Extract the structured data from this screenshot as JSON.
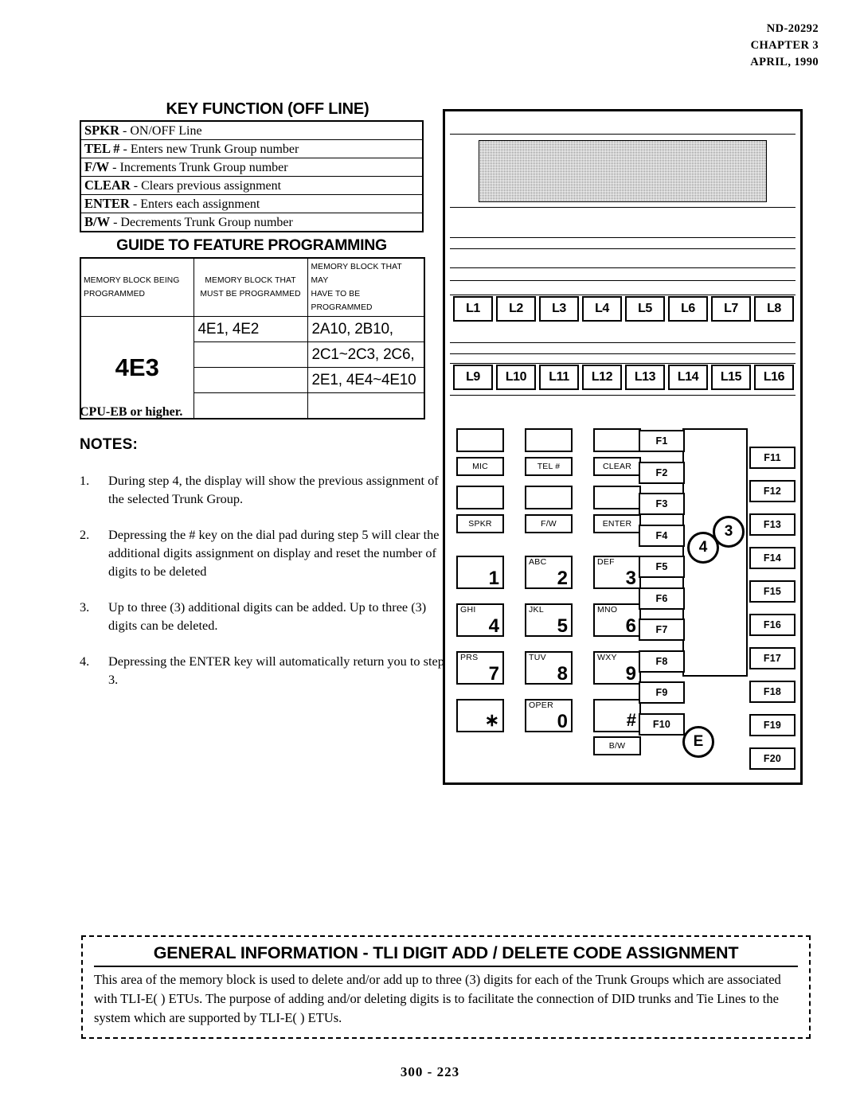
{
  "header": {
    "doc_number": "ND-20292",
    "chapter": "CHAPTER 3",
    "date": "APRIL, 1990"
  },
  "key_function": {
    "title": "KEY FUNCTION (OFF LINE)",
    "rows": [
      {
        "key": "SPKR",
        "sep": " -  ",
        "desc": "ON/OFF Line"
      },
      {
        "key": "TEL #",
        "sep": " - ",
        "desc": "Enters new Trunk Group number"
      },
      {
        "key": "F/W",
        "sep": " -  ",
        "desc": "Increments  Trunk Group number"
      },
      {
        "key": "CLEAR",
        "sep": " -  ",
        "desc": "Clears previous assignment"
      },
      {
        "key": "ENTER",
        "sep": " - ",
        "desc": "Enters each assignment"
      },
      {
        "key": "B/W",
        "sep": " -  ",
        "desc": "Decrements Trunk Group number"
      }
    ]
  },
  "guide": {
    "title": "GUIDE TO FEATURE PROGRAMMING",
    "headers": {
      "col1_line1": "MEMORY BLOCK BEING",
      "col1_line2": "PROGRAMMED",
      "col2_line1": "MEMORY BLOCK THAT",
      "col2_line2": "MUST BE PROGRAMMED",
      "col3_line1": "MEMORY BLOCK THAT MAY",
      "col3_line2": "HAVE TO BE PROGRAMMED"
    },
    "memory_block": "4E3",
    "must_rows": [
      "4E1, 4E2",
      "",
      "",
      ""
    ],
    "may_rows": [
      "2A10, 2B10,",
      "2C1~2C3, 2C6,",
      "2E1, 4E4~4E10",
      ""
    ],
    "cpu_note": "CPU-EB or higher."
  },
  "notes": {
    "title": "NOTES:",
    "items": [
      {
        "num": "1.",
        "text": "During step 4,  the display will show the previous assignment of the selected Trunk Group."
      },
      {
        "num": "2.",
        "text": "Depressing the # key on the dial pad during step 5 will clear the additional digits assignment on display and reset the number of digits to be deleted"
      },
      {
        "num": "3.",
        "text": "Up to three (3) additional digits can be added.  Up to three (3) digits can be deleted."
      },
      {
        "num": "4.",
        "text": "Depressing the ENTER key will  automatically return you to step 3."
      }
    ]
  },
  "phone": {
    "line_keys_row1": [
      "L1",
      "L2",
      "L3",
      "L4",
      "L5",
      "L6",
      "L7",
      "L8"
    ],
    "line_keys_row2": [
      "L9",
      "L10",
      "L11",
      "L12",
      "L13",
      "L14",
      "L15",
      "L16"
    ],
    "control_keys": [
      "MIC",
      "TEL #",
      "CLEAR",
      "SPKR",
      "F/W",
      "ENTER"
    ],
    "bw_key": "B/W",
    "dial_keys": [
      {
        "letters": "",
        "digit": "1"
      },
      {
        "letters": "ABC",
        "digit": "2"
      },
      {
        "letters": "DEF",
        "digit": "3"
      },
      {
        "letters": "GHI",
        "digit": "4"
      },
      {
        "letters": "JKL",
        "digit": "5"
      },
      {
        "letters": "MNO",
        "digit": "6"
      },
      {
        "letters": "PRS",
        "digit": "7"
      },
      {
        "letters": "TUV",
        "digit": "8"
      },
      {
        "letters": "WXY",
        "digit": "9"
      },
      {
        "letters": "",
        "digit": "∗"
      },
      {
        "letters": "OPER",
        "digit": "0"
      },
      {
        "letters": "",
        "digit": "#"
      }
    ],
    "function_keys_left": [
      "F1",
      "F2",
      "F3",
      "F4",
      "F5",
      "F6",
      "F7",
      "F8",
      "F9",
      "F10"
    ],
    "function_keys_right": [
      "F11",
      "F12",
      "F13",
      "F14",
      "F15",
      "F16",
      "F17",
      "F18",
      "F19",
      "F20"
    ],
    "callouts": [
      "3",
      "4",
      "E"
    ],
    "lcd_color": "#8c8c8c"
  },
  "general_info": {
    "title": "GENERAL INFORMATION  - TLI  DIGIT ADD / DELETE  CODE  ASSIGNMENT",
    "body": "This area of the memory block is used to delete and/or add up to three (3) digits for each of the Trunk Groups which are associated with TLI-E( ) ETUs.  The purpose of adding and/or deleting digits is to facilitate the connection of DID trunks and Tie Lines to the system which are supported by TLI-E( ) ETUs."
  },
  "footer": {
    "page_number": "300 - 223"
  }
}
